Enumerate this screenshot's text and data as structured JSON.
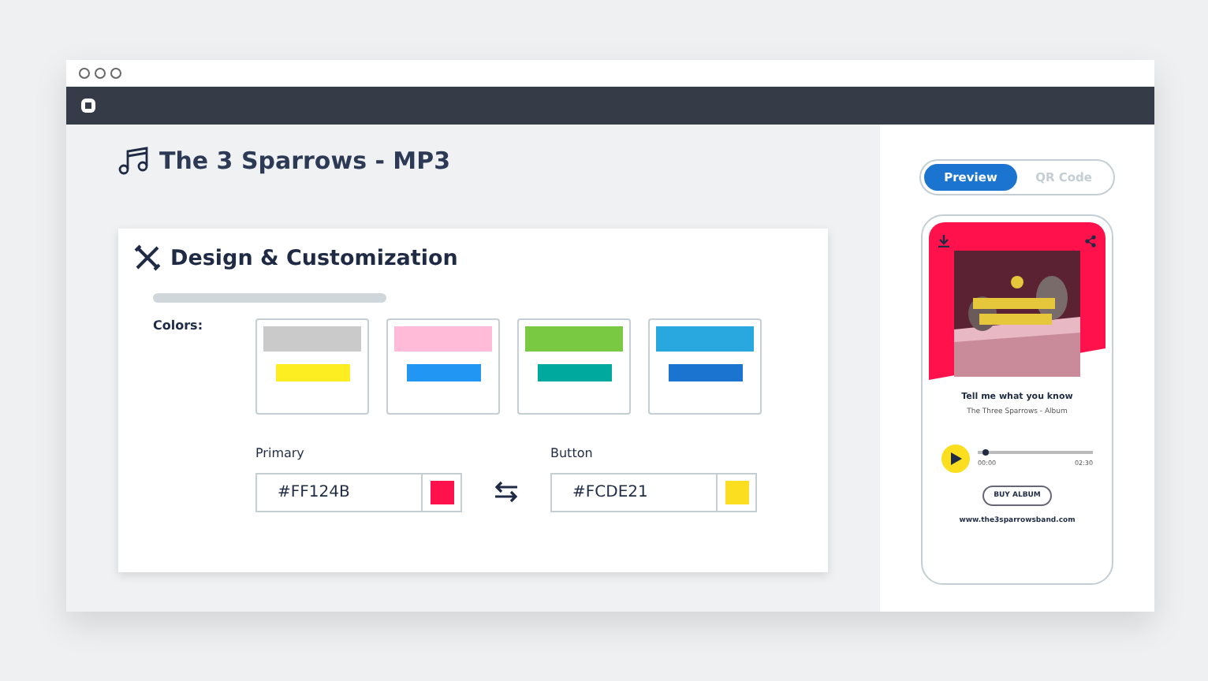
{
  "page_title": "The 3 Sparrows - MP3",
  "card": {
    "title": "Design & Customization",
    "colors_label": "Colors:",
    "presets": [
      {
        "selected": false,
        "swatches": [
          {
            "color": "#cacaca"
          },
          {
            "color": "#fcee21"
          }
        ]
      },
      {
        "selected": false,
        "swatches": [
          {
            "color": "#ffbbd7"
          },
          {
            "color": "#2196f3"
          }
        ]
      },
      {
        "selected": false,
        "swatches": [
          {
            "color": "#7ac943"
          },
          {
            "color": "#00a99d"
          }
        ]
      },
      {
        "selected": false,
        "swatches": [
          {
            "color": "#29a8e0"
          },
          {
            "color": "#1b75d0"
          }
        ]
      }
    ],
    "fields": [
      {
        "label": "Primary",
        "value": "#FF124B",
        "color": "#ff124b"
      },
      {
        "label": "Button",
        "value": "#FCDE21",
        "color": "#fcde21"
      }
    ]
  },
  "preview": {
    "tabs": [
      {
        "label": "Preview",
        "selected": true
      },
      {
        "label": "QR Code",
        "selected": false
      }
    ],
    "phone": {
      "track": "Tell me what you know",
      "album": "The Three Sparrows - Album",
      "level": 0.07,
      "time_start": "00:00",
      "time_end": "02:30",
      "buy": "BUY ALBUM",
      "website": "www.the3sparrowsband.com"
    }
  }
}
